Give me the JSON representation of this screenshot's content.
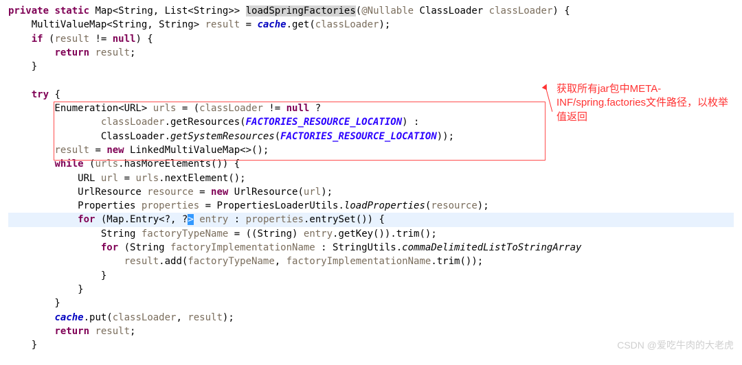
{
  "annotation": "获取所有jar包中META-INF/spring.factories文件路径，以枚举值返回",
  "watermark": "CSDN @爱吃牛肉的大老虎",
  "code": {
    "kw_private": "private",
    "kw_static": "static",
    "type_map": "Map<String, List<String>>",
    "method_name": "loadSpringFactories",
    "anno": "@Nullable",
    "type_cl": "ClassLoader",
    "p_cl": "classLoader",
    "line1_b": ") {",
    "line2_a": "    MultiValueMap<String, String> ",
    "p_result": "result",
    "line2_b": " = ",
    "field_cache": "cache",
    "line2_c": ".get(",
    "line2_d": ");",
    "kw_if": "if",
    "line3_a": " (",
    "line3_b": " != ",
    "kw_null": "null",
    "line3_c": ") {",
    "kw_return": "return",
    "line4_b": ";",
    "line5": "    }",
    "blank": " ",
    "kw_try": "try",
    "line7_b": " {",
    "line8_a": "        Enumeration<URL> ",
    "p_urls": "urls",
    "line8_b": " = (",
    "line8_c": " != ",
    "line8_d": " ?",
    "line9_a": "                ",
    "line9_b": ".getResources(",
    "const1": "FACTORIES_RESOURCE_LOCATION",
    "line9_c": ") :",
    "line10_a": "                ClassLoader.",
    "m_getsys": "getSystemResources",
    "line10_b": "(",
    "line10_c": "));",
    "line11_a": "        ",
    "line11_b": " = ",
    "kw_new": "new",
    "line11_c": " LinkedMultiValueMap<>();",
    "kw_while": "while",
    "line12_a": " (",
    "line12_b": ".hasMoreElements()) {",
    "line13_a": "            URL ",
    "p_url": "url",
    "line13_b": " = ",
    "line13_c": ".nextElement();",
    "line14_a": "            UrlResource ",
    "p_res": "resource",
    "line14_b": " = ",
    "line14_c": " UrlResource(",
    "line14_d": ");",
    "line15_a": "            Properties ",
    "p_props": "properties",
    "line15_b": " = PropertiesLoaderUtils.",
    "m_loadprops": "loadProperties",
    "line15_c": "(",
    "line15_d": ");",
    "kw_for": "for",
    "line16_a": " (Map.Entry",
    "gen_open": "<",
    "q1": "?",
    "comma": ", ",
    "q2": "?",
    "gen_close": ">",
    "p_entry": "entry",
    "line16_b": " : ",
    "line16_c": ".entrySet()) {",
    "line17_a": "                String ",
    "p_ftn": "factoryTypeName",
    "line17_b": " = ((String) ",
    "line17_c": ".getKey()).trim();",
    "line18_a": " (String ",
    "p_fin": "factoryImplementationName",
    "line18_b": " : StringUtils.",
    "m_comma": "commaDelimitedListToStringArray",
    "line19_a": "                    ",
    "line19_b": ".add(",
    "line19_c": ", ",
    "line19_d": ".trim());",
    "line20": "                }",
    "line21": "            }",
    "line22": "        }",
    "line23_a": "        ",
    "line23_b": ".put(",
    "line23_c": ", ",
    "line23_d": ");",
    "line24_b": ";",
    "line25": "    }"
  }
}
